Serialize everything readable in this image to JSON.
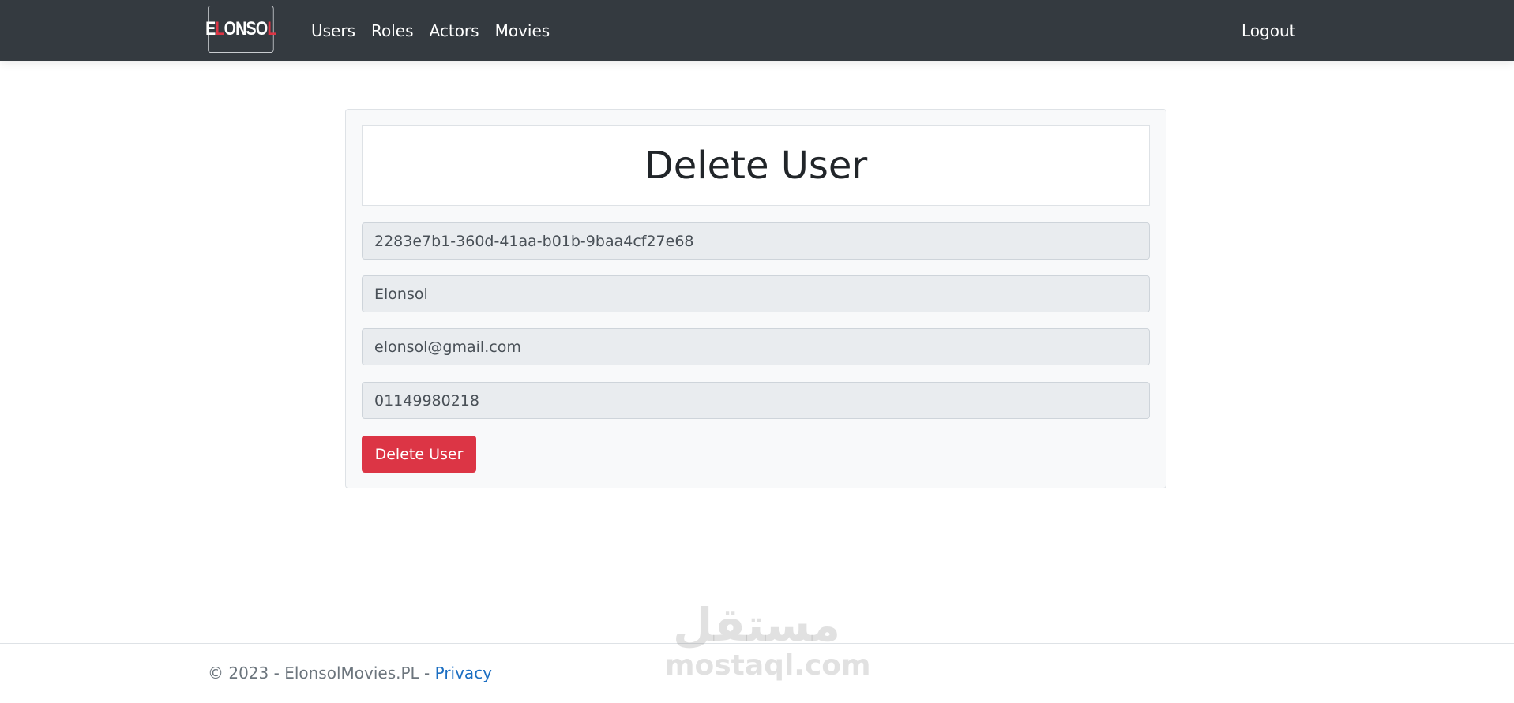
{
  "navbar": {
    "brand_parts": [
      "E",
      "L",
      "ONSO",
      "L"
    ],
    "links": [
      {
        "label": "Users"
      },
      {
        "label": "Roles"
      },
      {
        "label": "Actors"
      },
      {
        "label": "Movies"
      }
    ],
    "logout_label": "Logout"
  },
  "form": {
    "title": "Delete User",
    "fields": {
      "id": "2283e7b1-360d-41aa-b01b-9baa4cf27e68",
      "username": "Elonsol",
      "email": "elonsol@gmail.com",
      "phone": "01149980218"
    },
    "submit_label": "Delete User"
  },
  "footer": {
    "copyright": "© 2023 - ElonsolMovies.PL - ",
    "privacy_label": "Privacy"
  },
  "watermark": {
    "arabic": "مستقل",
    "latin": "mostaql.com"
  },
  "colors": {
    "navbar_bg": "#343a40",
    "danger": "#dc3545",
    "link": "#1b6ec2"
  }
}
